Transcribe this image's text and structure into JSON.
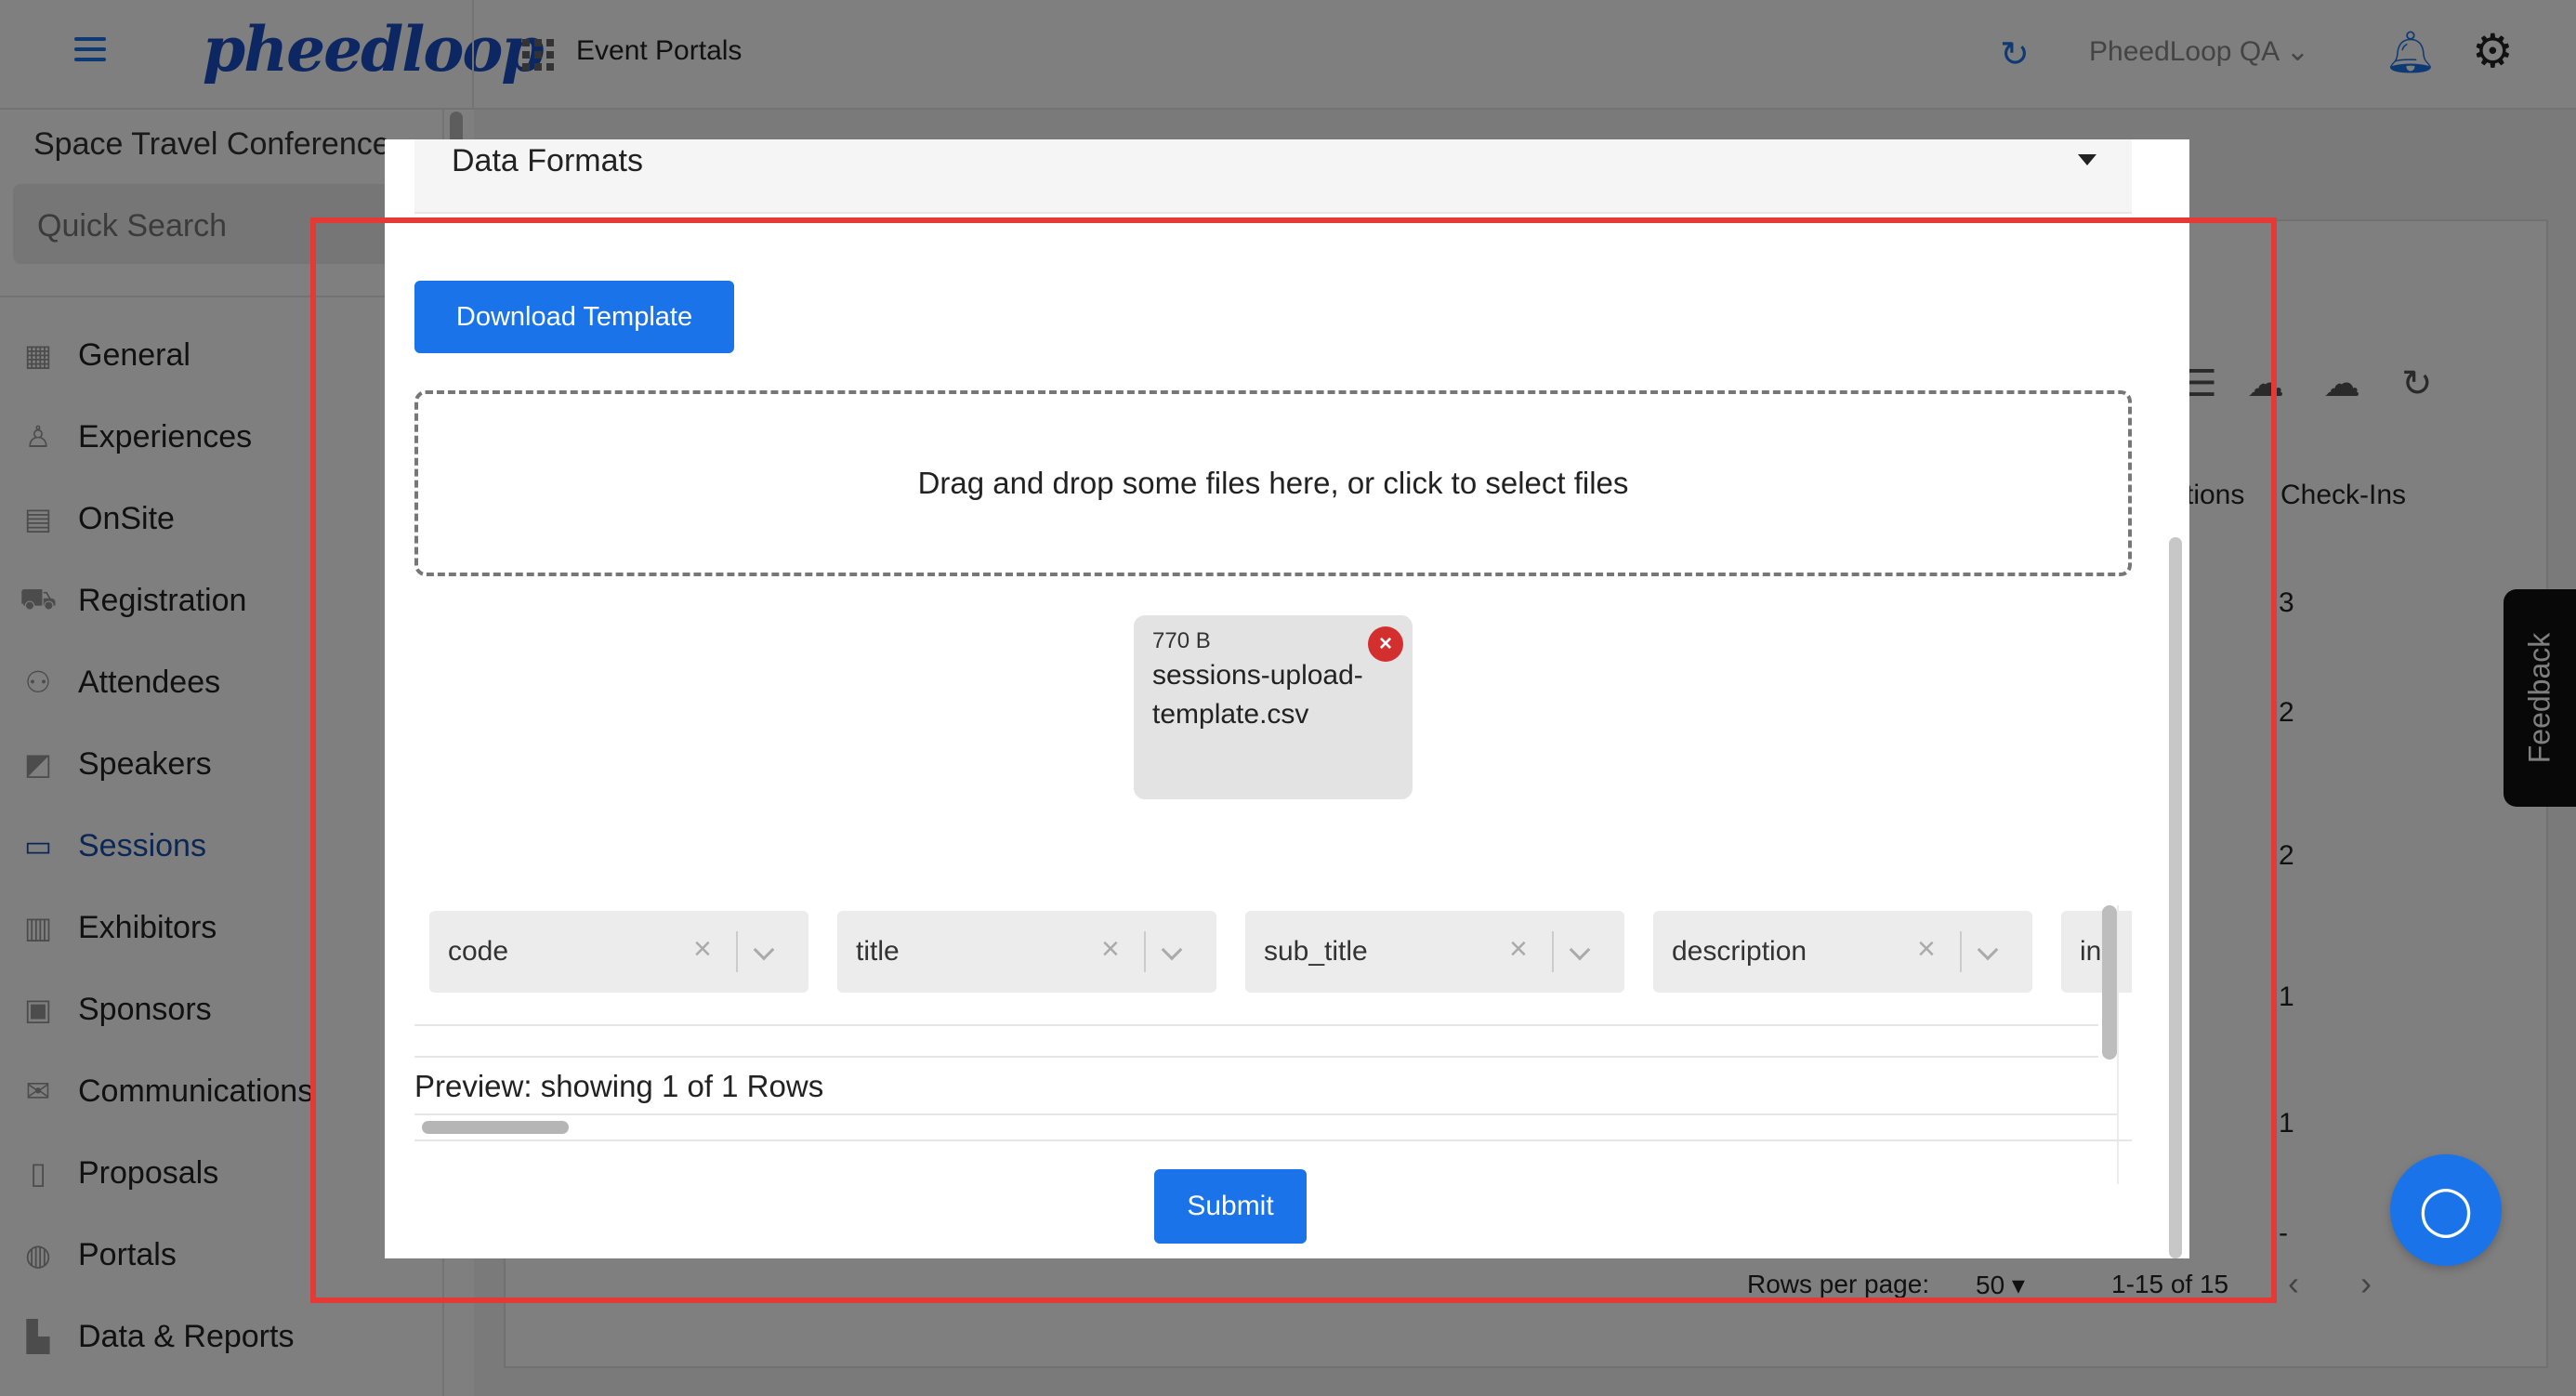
{
  "topbar": {
    "logo_text": "pheedloop",
    "portal_title": "Event Portals",
    "org_name": "PheedLoop QA",
    "org_caret": "⌄"
  },
  "sidebar": {
    "event_name": "Space Travel Conference",
    "quick_search_placeholder": "Quick Search",
    "items": [
      {
        "label": "General",
        "icon": "grid-icon"
      },
      {
        "label": "Experiences",
        "icon": "person-icon"
      },
      {
        "label": "OnSite",
        "icon": "printer-icon"
      },
      {
        "label": "Registration",
        "icon": "cart-icon"
      },
      {
        "label": "Attendees",
        "icon": "people-icon"
      },
      {
        "label": "Speakers",
        "icon": "speaker-icon"
      },
      {
        "label": "Sessions",
        "icon": "laptop-icon"
      },
      {
        "label": "Exhibitors",
        "icon": "store-icon"
      },
      {
        "label": "Sponsors",
        "icon": "badge-icon"
      },
      {
        "label": "Communications",
        "icon": "mail-icon"
      },
      {
        "label": "Proposals",
        "icon": "document-icon"
      },
      {
        "label": "Portals",
        "icon": "globe-icon"
      },
      {
        "label": "Data & Reports",
        "icon": "chart-icon"
      }
    ],
    "active": "Sessions"
  },
  "background_table": {
    "partial_header": "tions",
    "checkins_header": "Check-Ins",
    "checkins_values": [
      "3",
      "2",
      "2",
      "1",
      "1",
      "-"
    ],
    "rows_per_page_label": "Rows per page:",
    "rows_per_page_value": "50",
    "range": "1-15 of 15"
  },
  "feedback_label": "Feedback",
  "modal": {
    "accordion_label": "Data Formats",
    "download_button": "Download Template",
    "dropzone_text": "Drag and drop some files here, or click to select files",
    "file": {
      "size": "770 B",
      "name": "sessions-upload-template.csv"
    },
    "column_mappings": [
      "code",
      "title",
      "sub_title",
      "description",
      "in"
    ],
    "preview_text": "Preview: showing 1 of 1 Rows",
    "submit_button": "Submit"
  },
  "colors": {
    "primary": "#1a73e8",
    "highlight": "#e53935",
    "remove": "#d32f2f"
  }
}
